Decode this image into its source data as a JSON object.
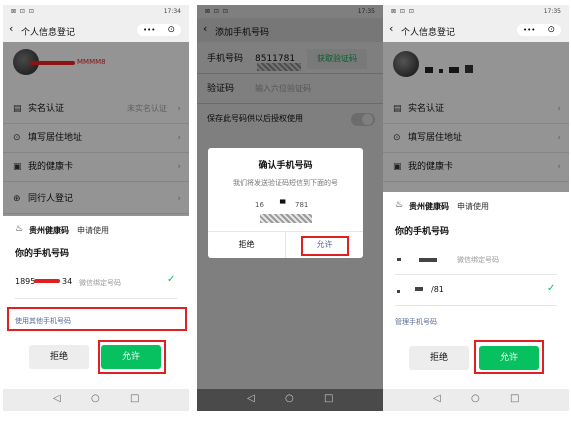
{
  "colors": {
    "accent": "#07c160",
    "highlight": "#e02020",
    "link": "#576b95"
  },
  "status": {
    "left_icons": "⊠ ⊡ ⊡",
    "right_time": "17:34",
    "right_time2": "17:35",
    "right_time3": "17:35"
  },
  "panel1": {
    "title": "个人信息登记",
    "menu_dots": "•••",
    "user_number_fragment": "MMMM8",
    "rows": [
      {
        "icon": "id-card-icon",
        "glyph": "▤",
        "label": "实名认证",
        "sub": "未实名认证"
      },
      {
        "icon": "location-icon",
        "glyph": "⊙",
        "label": "填写居住地址",
        "sub": ""
      },
      {
        "icon": "health-card-icon",
        "glyph": "▣",
        "label": "我的健康卡",
        "sub": ""
      },
      {
        "icon": "add-person-icon",
        "glyph": "⊕",
        "label": "同行人登记",
        "sub": ""
      }
    ],
    "sheet": {
      "app_name": "贵州健康码",
      "request": "申请使用",
      "heading": "你的手机号码",
      "phone_prefix": "1895",
      "phone_suffix": "34",
      "phone_note": "微信绑定号码",
      "use_other": "使用其他手机号码",
      "reject": "拒绝",
      "allow": "允许"
    }
  },
  "panel2": {
    "title": "添加手机号码",
    "phone_label": "手机号码",
    "phone_value": "8511781",
    "get_code": "获取验证码",
    "code_label": "验证码",
    "code_placeholder": "输入六位验证码",
    "save_label": "保存此号码供以后授权使用",
    "dialog": {
      "title": "确认手机号码",
      "message": "我们将发送验证码短信到下面的号",
      "number_prefix": "16",
      "number_suffix": "781",
      "reject": "拒绝",
      "allow": "允许"
    }
  },
  "panel3": {
    "title": "个人信息登记",
    "rows": [
      {
        "icon": "id-card-icon",
        "glyph": "▤",
        "label": "实名认证",
        "sub": ""
      },
      {
        "icon": "location-icon",
        "glyph": "⊙",
        "label": "填写居住地址",
        "sub": ""
      },
      {
        "icon": "health-card-icon",
        "glyph": "▣",
        "label": "我的健康卡",
        "sub": ""
      }
    ],
    "sheet": {
      "app_name": "贵州健康码",
      "request": "申请使用",
      "heading": "你的手机号码",
      "phone1_note": "微信绑定号码",
      "phone2_suffix": "/81",
      "manage": "管理手机号码",
      "reject": "拒绝",
      "allow": "允许"
    }
  },
  "navbar": {
    "back": "◁",
    "home": "○",
    "recent": "□"
  }
}
